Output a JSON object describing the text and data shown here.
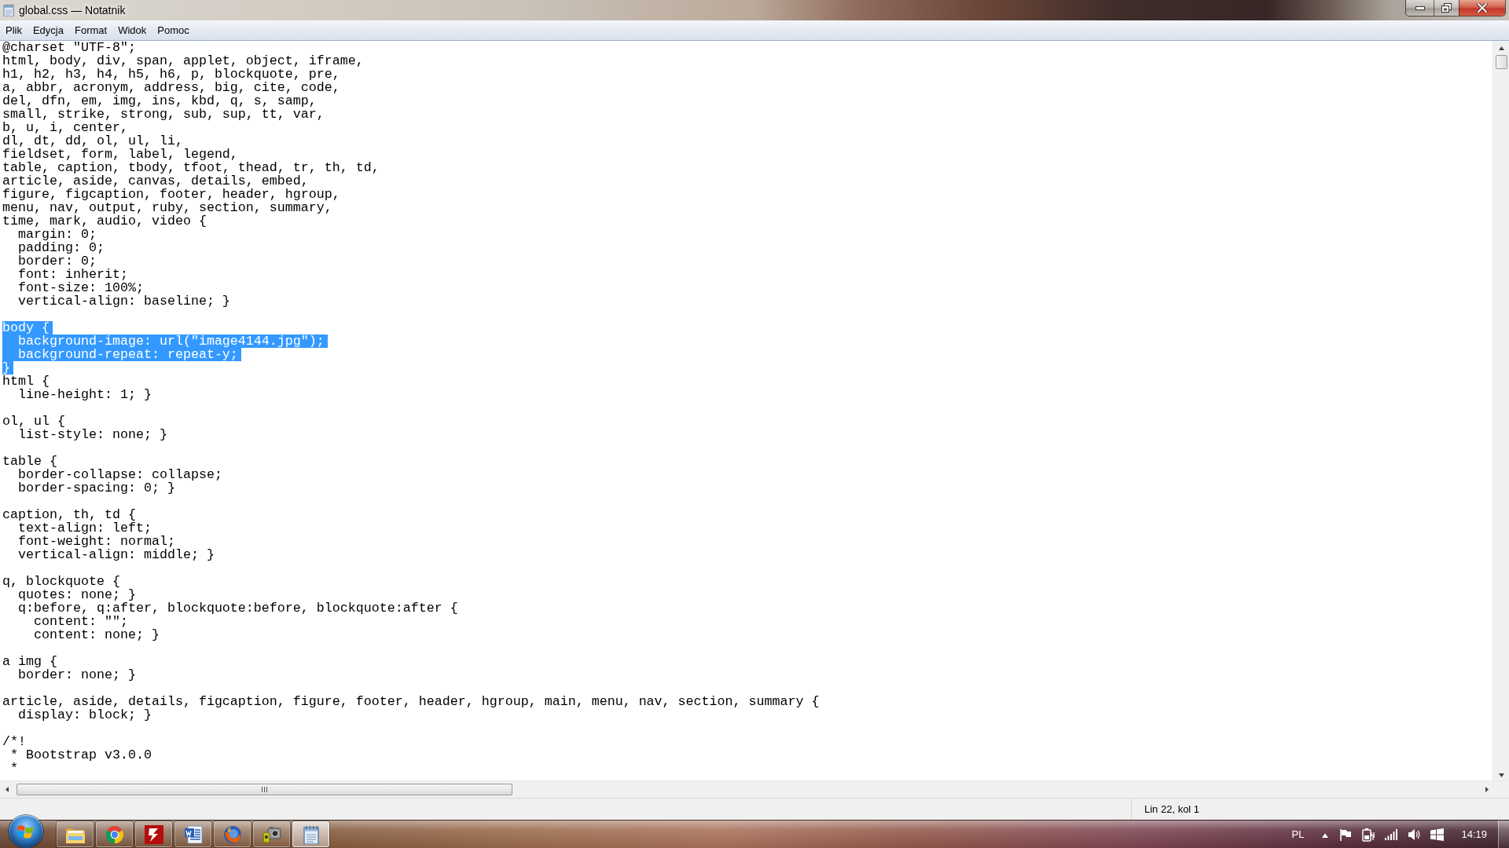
{
  "window": {
    "title": "global.css — Notatnik"
  },
  "menu_bar": [
    "Plik",
    "Edycja",
    "Format",
    "Widok",
    "Pomoc"
  ],
  "editor": {
    "blocks": [
      {
        "lines": [
          {
            "text": "@charset \"UTF-8\";",
            "selected": false
          },
          {
            "text": "html, body, div, span, applet, object, iframe,",
            "selected": false
          },
          {
            "text": "h1, h2, h3, h4, h5, h6, p, blockquote, pre,",
            "selected": false
          },
          {
            "text": "a, abbr, acronym, address, big, cite, code,",
            "selected": false
          },
          {
            "text": "del, dfn, em, img, ins, kbd, q, s, samp,",
            "selected": false
          },
          {
            "text": "small, strike, strong, sub, sup, tt, var,",
            "selected": false
          },
          {
            "text": "b, u, i, center,",
            "selected": false
          },
          {
            "text": "dl, dt, dd, ol, ul, li,",
            "selected": false
          },
          {
            "text": "fieldset, form, label, legend,",
            "selected": false
          },
          {
            "text": "table, caption, tbody, tfoot, thead, tr, th, td,",
            "selected": false
          },
          {
            "text": "article, aside, canvas, details, embed,",
            "selected": false
          },
          {
            "text": "figure, figcaption, footer, header, hgroup,",
            "selected": false
          },
          {
            "text": "menu, nav, output, ruby, section, summary,",
            "selected": false
          },
          {
            "text": "time, mark, audio, video {",
            "selected": false
          },
          {
            "text": "  margin: 0;",
            "selected": false
          },
          {
            "text": "  padding: 0;",
            "selected": false
          },
          {
            "text": "  border: 0;",
            "selected": false
          },
          {
            "text": "  font: inherit;",
            "selected": false
          },
          {
            "text": "  font-size: 100%;",
            "selected": false
          },
          {
            "text": "  vertical-align: baseline; }",
            "selected": false
          }
        ]
      },
      {
        "lines": [
          {
            "text": "body {",
            "selected": true
          },
          {
            "text": "  background-image: url(\"image4144.jpg\");",
            "selected": true
          },
          {
            "text": "  background-repeat: repeat-y;",
            "selected": true
          },
          {
            "text": "}",
            "selected": true
          },
          {
            "text": "html {",
            "selected": false
          },
          {
            "text": "  line-height: 1; }",
            "selected": false
          }
        ]
      },
      {
        "lines": [
          {
            "text": "ol, ul {",
            "selected": false
          },
          {
            "text": "  list-style: none; }",
            "selected": false
          }
        ]
      },
      {
        "lines": [
          {
            "text": "table {",
            "selected": false
          },
          {
            "text": "  border-collapse: collapse;",
            "selected": false
          },
          {
            "text": "  border-spacing: 0; }",
            "selected": false
          }
        ]
      },
      {
        "lines": [
          {
            "text": "caption, th, td {",
            "selected": false
          },
          {
            "text": "  text-align: left;",
            "selected": false
          },
          {
            "text": "  font-weight: normal;",
            "selected": false
          },
          {
            "text": "  vertical-align: middle; }",
            "selected": false
          }
        ]
      },
      {
        "lines": [
          {
            "text": "q, blockquote {",
            "selected": false
          },
          {
            "text": "  quotes: none; }",
            "selected": false
          },
          {
            "text": "  q:before, q:after, blockquote:before, blockquote:after {",
            "selected": false
          },
          {
            "text": "    content: \"\";",
            "selected": false
          },
          {
            "text": "    content: none; }",
            "selected": false
          }
        ]
      },
      {
        "lines": [
          {
            "text": "a img {",
            "selected": false
          },
          {
            "text": "  border: none; }",
            "selected": false
          }
        ]
      },
      {
        "lines": [
          {
            "text": "article, aside, details, figcaption, figure, footer, header, hgroup, main, menu, nav, section, summary {",
            "selected": false
          },
          {
            "text": "  display: block; }",
            "selected": false
          }
        ]
      },
      {
        "lines": [
          {
            "text": "/*!",
            "selected": false
          },
          {
            "text": " * Bootstrap v3.0.0",
            "selected": false
          },
          {
            "text": " *",
            "selected": false
          }
        ]
      }
    ]
  },
  "status_bar": {
    "position": "Lin 22, kol 1"
  },
  "taskbar": {
    "buttons": [
      {
        "kind": "folder",
        "selected": false
      },
      {
        "kind": "ring-logo",
        "selected": false
      },
      {
        "kind": "bolt-tile",
        "selected": false
      },
      {
        "kind": "document",
        "selected": false
      },
      {
        "kind": "globe",
        "selected": false
      },
      {
        "kind": "camera",
        "selected": false
      },
      {
        "kind": "notepad",
        "selected": true
      }
    ],
    "language": "PL",
    "clock": "14:19"
  }
}
